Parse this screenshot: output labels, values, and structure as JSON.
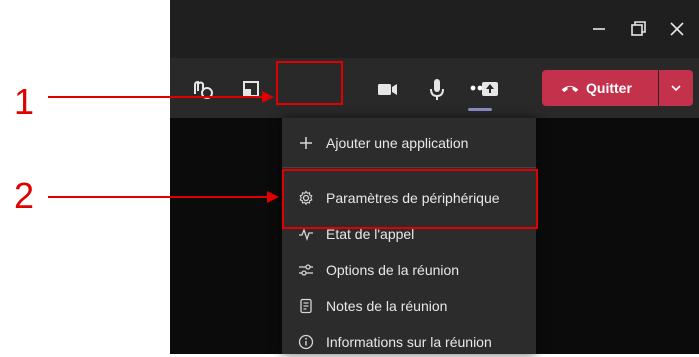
{
  "toolbar": {
    "quit_label": "Quitter"
  },
  "menu": {
    "items": [
      {
        "label": "Ajouter une application",
        "icon": "plus-icon"
      },
      {
        "label": "Paramètres de périphérique",
        "icon": "gear-icon"
      },
      {
        "label": "État de l'appel",
        "icon": "pulse-icon"
      },
      {
        "label": "Options de la réunion",
        "icon": "sliders-icon"
      },
      {
        "label": "Notes de la réunion",
        "icon": "note-icon"
      },
      {
        "label": "Informations sur la réunion",
        "icon": "info-icon"
      }
    ]
  },
  "callouts": {
    "first": "1",
    "second": "2"
  },
  "colors": {
    "accent_red": "#c4314b",
    "callout_red": "#e00000",
    "menu_bg": "#2d2c2c",
    "toolbar_bg": "#292929"
  }
}
